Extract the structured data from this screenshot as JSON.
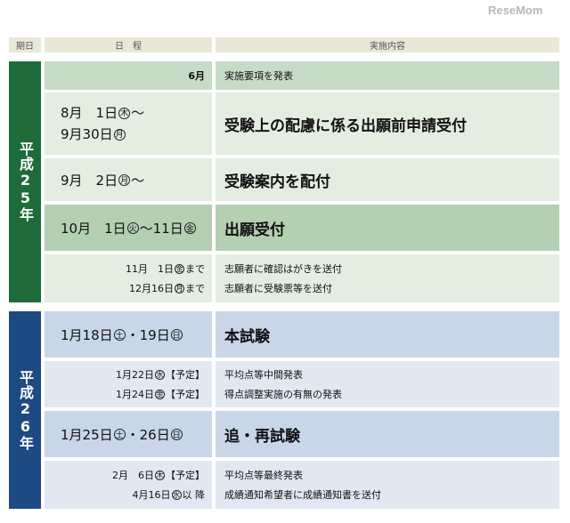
{
  "watermark": "ReseMom",
  "header": {
    "col_period": "期日",
    "col_schedule": "日　程",
    "col_content": "実施内容"
  },
  "era1": {
    "label": "平成25年",
    "color": "#1f6b3a"
  },
  "era2": {
    "label": "平成26年",
    "color": "#1d4a82"
  },
  "rows1": [
    {
      "date": "6月",
      "content": "実施要項を発表"
    },
    {
      "date_line1_pre": "8月　1日",
      "date_line1_day": "木",
      "date_line1_post": "～",
      "date_line2_pre": "9月30日",
      "date_line2_day": "月",
      "content": "受験上の配慮に係る出願前申請受付"
    },
    {
      "date_pre": "9月　2日",
      "date_day": "月",
      "date_post": "～",
      "content": "受験案内を配付"
    },
    {
      "date_pre": "10月　1日",
      "date_day1": "火",
      "date_mid": "～11日",
      "date_day2": "金",
      "content": "出願受付"
    },
    {
      "sub": [
        {
          "date_pre": "11月　1日",
          "date_day": "金",
          "date_post": "まで",
          "content": "志願者に確認はがきを送付"
        },
        {
          "date_pre": "12月16日",
          "date_day": "月",
          "date_post": "まで",
          "content": "志願者に受験票等を送付"
        }
      ]
    }
  ],
  "rows2": [
    {
      "date_pre": "1月18日",
      "date_day1": "土",
      "date_mid": "・19日",
      "date_day2": "日",
      "content": "本試験"
    },
    {
      "sub": [
        {
          "date_pre": "1月22日",
          "date_day": "水",
          "date_post": "【予定】",
          "content": "平均点等中間発表"
        },
        {
          "date_pre": "1月24日",
          "date_day": "金",
          "date_post": "【予定】",
          "content": "得点調整実施の有無の発表"
        }
      ]
    },
    {
      "date_pre": "1月25日",
      "date_day1": "土",
      "date_mid": "・26日",
      "date_day2": "日",
      "content": "追・再試験"
    },
    {
      "sub": [
        {
          "date_pre": "2月　6日",
          "date_day": "木",
          "date_post": "【予定】",
          "content": "平均点等最終発表"
        },
        {
          "date_pre": "4月16日",
          "date_day": "水",
          "date_post": "以 降",
          "content": "成績通知希望者に成績通知書を送付"
        }
      ]
    }
  ]
}
